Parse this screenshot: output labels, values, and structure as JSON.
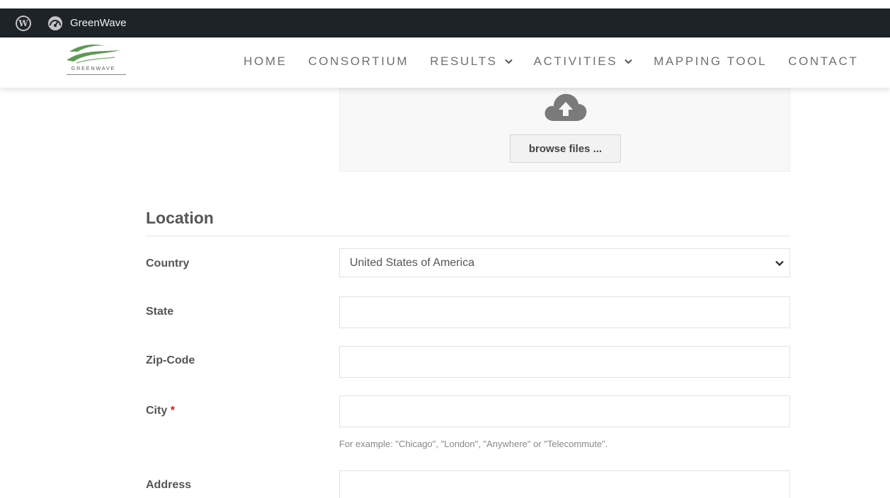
{
  "admin_bar": {
    "site_name": "GreenWave",
    "icons": [
      "wordpress-icon",
      "dashboard-gauge-icon"
    ]
  },
  "header": {
    "logo_text": "GREENWAVE",
    "nav": [
      {
        "label": "HOME",
        "has_dropdown": false
      },
      {
        "label": "CONSORTIUM",
        "has_dropdown": false
      },
      {
        "label": "RESULTS",
        "has_dropdown": true
      },
      {
        "label": "ACTIVITIES",
        "has_dropdown": true
      },
      {
        "label": "MAPPING TOOL",
        "has_dropdown": false
      },
      {
        "label": "CONTACT",
        "has_dropdown": false
      }
    ]
  },
  "upload": {
    "icon": "cloud-upload-icon",
    "button_label": "browse files ..."
  },
  "location": {
    "title": "Location",
    "country": {
      "label": "Country",
      "value": "United States of America"
    },
    "state": {
      "label": "State",
      "value": ""
    },
    "zip": {
      "label": "Zip-Code",
      "value": ""
    },
    "city": {
      "label": "City",
      "required_mark": "*",
      "value": "",
      "hint": "For example: \"Chicago\", \"London\", \"Anywhere\" or \"Telecommute\"."
    },
    "address": {
      "label": "Address",
      "value": ""
    }
  },
  "colors": {
    "admin_bar_bg": "#1d2327",
    "nav_text": "#707070",
    "logo_green": "#5e9a55",
    "required": "#d01919"
  }
}
